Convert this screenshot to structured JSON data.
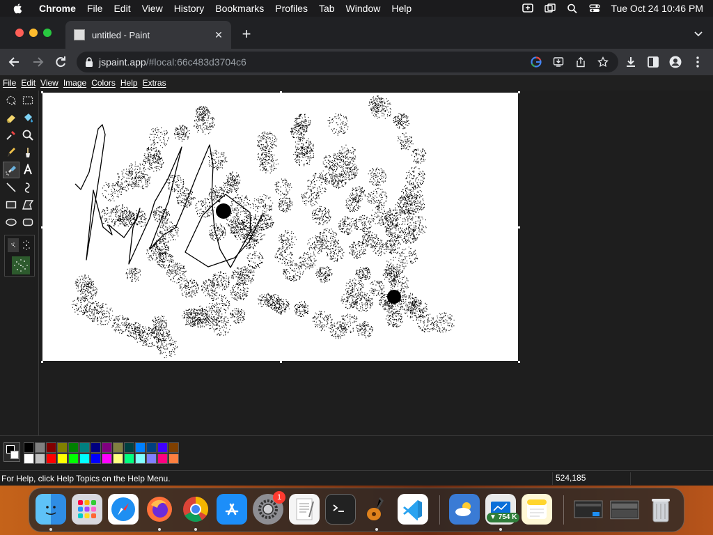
{
  "mac_menubar": {
    "app_name": "Chrome",
    "items": [
      "File",
      "Edit",
      "View",
      "History",
      "Bookmarks",
      "Profiles",
      "Tab",
      "Window",
      "Help"
    ],
    "clock": "Tue Oct 24  10:46 PM"
  },
  "chrome": {
    "tab_title": "untitled - Paint",
    "tab_close": "✕",
    "new_tab": "+",
    "url_host": "jspaint.app",
    "url_path": "/#local:66c483d3704c6"
  },
  "paint": {
    "menu": [
      "File",
      "Edit",
      "View",
      "Image",
      "Colors",
      "Help",
      "Extras"
    ],
    "status_help": "For Help, click Help Topics on the Help Menu.",
    "status_coords": "524,185",
    "foreground_color": "#000000",
    "background_color": "#ffffff",
    "palette_top": [
      "#000000",
      "#808080",
      "#800000",
      "#808000",
      "#008000",
      "#008080",
      "#000080",
      "#800080",
      "#808040",
      "#004040",
      "#0080ff",
      "#004080",
      "#4000ff",
      "#804000"
    ],
    "palette_bottom": [
      "#ffffff",
      "#c0c0c0",
      "#ff0000",
      "#ffff00",
      "#00ff00",
      "#00ffff",
      "#0000ff",
      "#ff00ff",
      "#ffff80",
      "#00ff80",
      "#80ffff",
      "#8080ff",
      "#ff0080",
      "#ff8040"
    ],
    "tools": [
      "free-form-select",
      "select",
      "eraser",
      "fill",
      "pick-color",
      "magnifier",
      "pencil",
      "brush",
      "airbrush",
      "text",
      "line",
      "curve",
      "rectangle",
      "polygon",
      "ellipse",
      "rounded-rectangle"
    ],
    "selected_tool": "airbrush"
  },
  "dock": {
    "system_settings_badge": "1",
    "network_badge": "▼ 754 K"
  }
}
